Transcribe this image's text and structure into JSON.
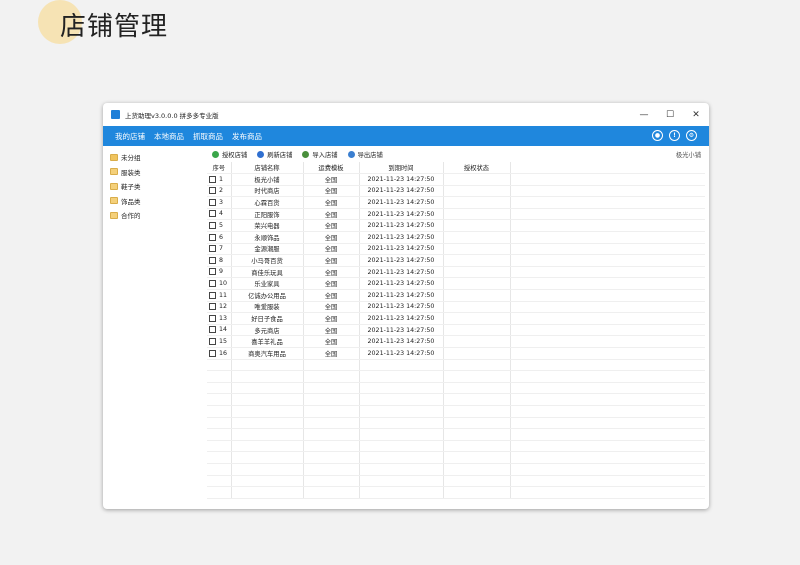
{
  "page": {
    "heading": "店铺管理",
    "accent": "#f6e3b4"
  },
  "window": {
    "title": "上货助理v3.0.0.0 拼多多专业版",
    "controls": [
      "—",
      "☐",
      "✕"
    ]
  },
  "menubar": {
    "color": "#1f87dd",
    "items": [
      "我的店铺",
      "本地商品",
      "抓取商品",
      "发布商品"
    ],
    "icons": [
      "user-icon",
      "info-icon",
      "settings-icon"
    ]
  },
  "sidebar": {
    "items": [
      {
        "label": "未分组",
        "root": true
      },
      {
        "label": "服装类"
      },
      {
        "label": "鞋子类"
      },
      {
        "label": "饰品类"
      },
      {
        "label": "合作的"
      }
    ]
  },
  "toolbar": {
    "buttons": [
      {
        "label": "授权店铺",
        "icon": "authorize-icon",
        "color": "#3aa64a"
      },
      {
        "label": "刷新店铺",
        "icon": "refresh-icon",
        "color": "#2f6fd0"
      },
      {
        "label": "导入店铺",
        "icon": "import-icon",
        "color": "#4a8f3c"
      },
      {
        "label": "导出店铺",
        "icon": "export-icon",
        "color": "#3b7fd0"
      }
    ],
    "right_text": "极光小铺"
  },
  "table": {
    "headers": [
      "序号",
      "店铺名称",
      "运费模板",
      "到期时间",
      "授权状态"
    ],
    "rows": [
      [
        "1",
        "极光小铺",
        "全国",
        "2021-11-23 14:27:50",
        ""
      ],
      [
        "2",
        "时代商店",
        "全国",
        "2021-11-23 14:27:50",
        ""
      ],
      [
        "3",
        "心霖百货",
        "全国",
        "2021-11-23 14:27:50",
        ""
      ],
      [
        "4",
        "正阳服饰",
        "全国",
        "2021-11-23 14:27:50",
        ""
      ],
      [
        "5",
        "荣兴电器",
        "全国",
        "2021-11-23 14:27:50",
        ""
      ],
      [
        "6",
        "永顺饰品",
        "全国",
        "2021-11-23 14:27:50",
        ""
      ],
      [
        "7",
        "金源潮服",
        "全国",
        "2021-11-23 14:27:50",
        ""
      ],
      [
        "8",
        "小马哥百货",
        "全国",
        "2021-11-23 14:27:50",
        ""
      ],
      [
        "9",
        "商佳乐玩具",
        "全国",
        "2021-11-23 14:27:50",
        ""
      ],
      [
        "10",
        "乐业家具",
        "全国",
        "2021-11-23 14:27:50",
        ""
      ],
      [
        "11",
        "亿诚办公用品",
        "全国",
        "2021-11-23 14:27:50",
        ""
      ],
      [
        "12",
        "唯爱服装",
        "全国",
        "2021-11-23 14:27:50",
        ""
      ],
      [
        "13",
        "好日子食品",
        "全国",
        "2021-11-23 14:27:50",
        ""
      ],
      [
        "14",
        "多元商店",
        "全国",
        "2021-11-23 14:27:50",
        ""
      ],
      [
        "15",
        "喜羊羊礼品",
        "全国",
        "2021-11-23 14:27:50",
        ""
      ],
      [
        "16",
        "商奥汽车用品",
        "全国",
        "2021-11-23 14:27:50",
        ""
      ]
    ]
  }
}
